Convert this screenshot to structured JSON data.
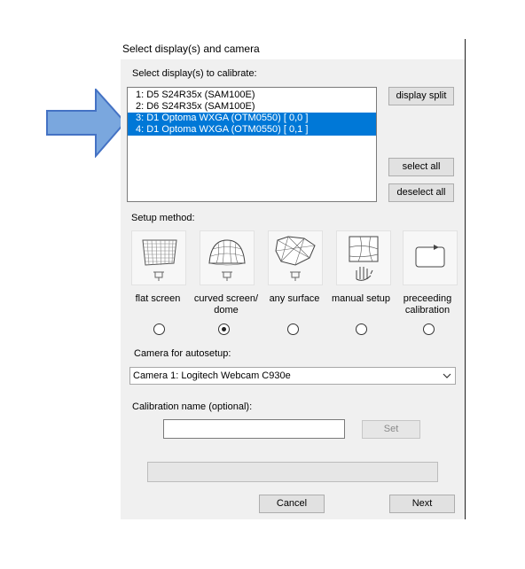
{
  "dialog": {
    "title": "Select display(s) and camera",
    "displays_label": "Select display(s) to calibrate:",
    "displays": [
      {
        "label": "1: D5 S24R35x (SAM100E)",
        "selected": false
      },
      {
        "label": "2: D6 S24R35x (SAM100E)",
        "selected": false
      },
      {
        "label": "3: D1 Optoma WXGA (OTM0550)  [ 0,0 ]",
        "selected": true
      },
      {
        "label": "4: D1 Optoma WXGA (OTM0550)  [ 0,1 ]",
        "selected": true
      }
    ],
    "buttons": {
      "display_split": "display split",
      "select_all": "select all",
      "deselect_all": "deselect all",
      "set": "Set",
      "cancel": "Cancel",
      "next": "Next"
    },
    "setup_method_label": "Setup method:",
    "setup_methods": [
      {
        "label": "flat screen",
        "icon": "flat-screen-grid-icon",
        "selected": false
      },
      {
        "label": "curved screen/ dome",
        "icon": "dome-grid-icon",
        "selected": true
      },
      {
        "label": "any surface",
        "icon": "any-surface-mesh-icon",
        "selected": false
      },
      {
        "label": "manual setup",
        "icon": "manual-setup-hand-icon",
        "selected": false
      },
      {
        "label": "preceeding calibration",
        "icon": "preceeding-calibration-icon",
        "selected": false
      }
    ],
    "camera_label": "Camera for autosetup:",
    "camera_selected": "Camera 1: Logitech Webcam C930e",
    "calibration_name_label": "Calibration name (optional):",
    "calibration_name_value": "",
    "progress": 0
  },
  "colors": {
    "selection": "#0078d7",
    "arrow_fill": "#7aa7de",
    "arrow_stroke": "#4472c4",
    "dialog_bg": "#f0f0f0"
  }
}
